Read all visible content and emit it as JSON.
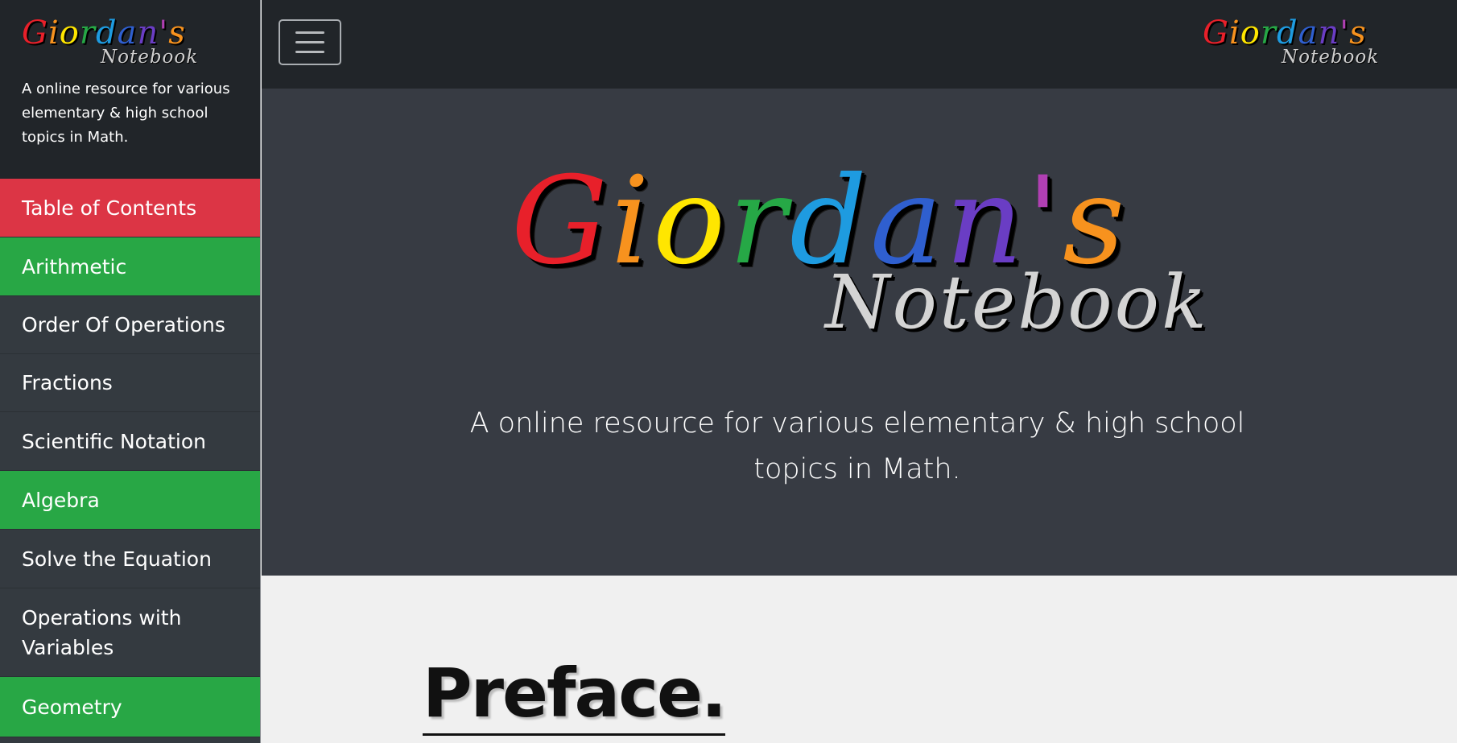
{
  "brand": {
    "script_letters": [
      {
        "ch": "G",
        "color": "#e8202a"
      },
      {
        "ch": "i",
        "color": "#f7921e"
      },
      {
        "ch": "o",
        "color": "#ffe600"
      },
      {
        "ch": "r",
        "color": "#26a846"
      },
      {
        "ch": "d",
        "color": "#1e9be0"
      },
      {
        "ch": "a",
        "color": "#2f5fcf"
      },
      {
        "ch": "n",
        "color": "#6a3dc4"
      },
      {
        "ch": "'",
        "color": "#b03fb3"
      },
      {
        "ch": "s",
        "color": "#f7921e"
      }
    ],
    "sub": "Notebook"
  },
  "sidebar": {
    "tagline": "A online resource for various elementary & high school topics in Math.",
    "items": [
      {
        "label": "Table of Contents",
        "style": "red"
      },
      {
        "label": "Arithmetic",
        "style": "green"
      },
      {
        "label": "Order Of Operations",
        "style": "dark"
      },
      {
        "label": "Fractions",
        "style": "dark"
      },
      {
        "label": "Scientific Notation",
        "style": "dark"
      },
      {
        "label": "Algebra",
        "style": "green"
      },
      {
        "label": "Solve the Equation",
        "style": "dark"
      },
      {
        "label": "Operations with Variables",
        "style": "dark"
      },
      {
        "label": "Geometry",
        "style": "green"
      }
    ]
  },
  "hero": {
    "tagline": "A online resource for various elementary & high school topics in Math."
  },
  "content": {
    "heading": "Preface."
  },
  "colors": {
    "sidebar_bg": "#343a40",
    "topbar_bg": "#212529",
    "hero_bg": "#373b43",
    "red": "#dc3545",
    "green": "#28a745"
  }
}
